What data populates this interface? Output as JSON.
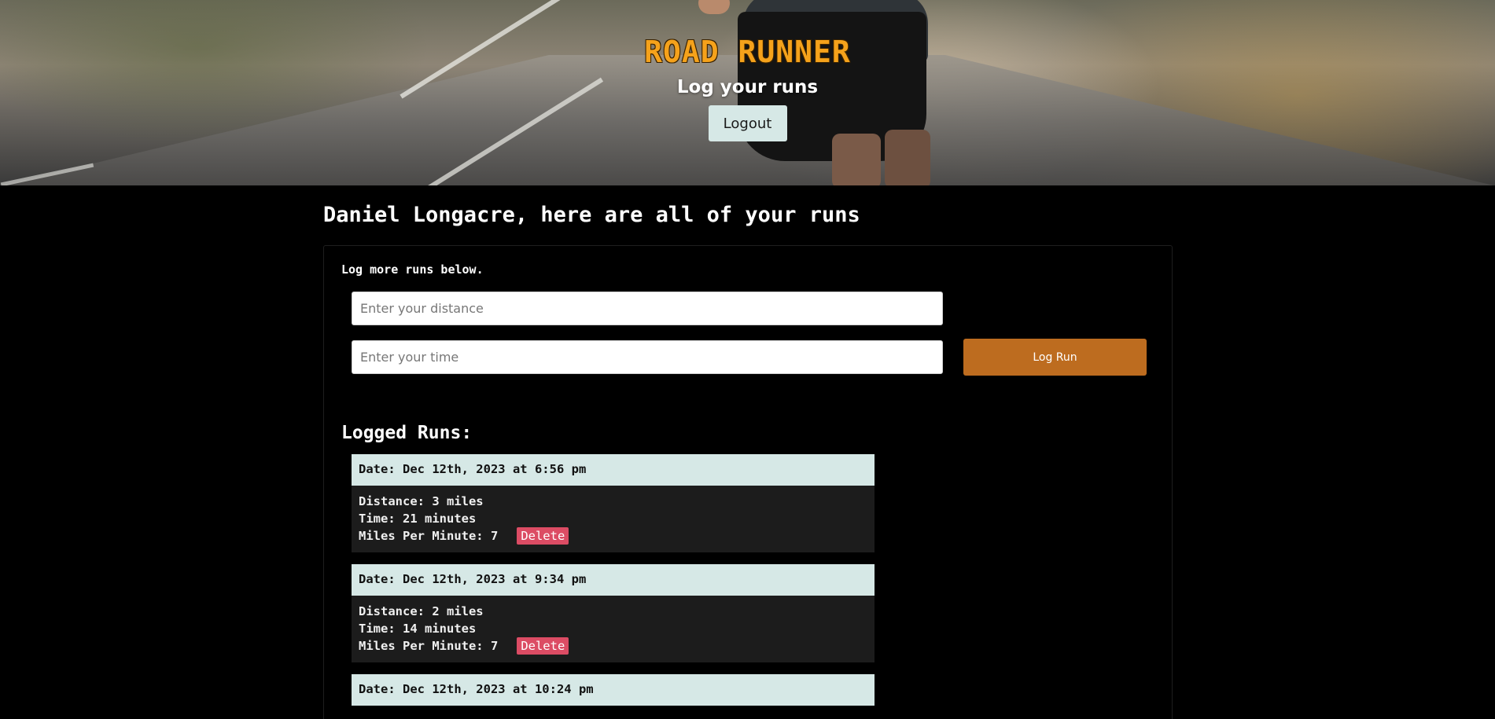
{
  "header": {
    "app_title": "ROAD RUNNER",
    "subtitle": "Log your runs",
    "logout_label": "Logout"
  },
  "main": {
    "heading": "Daniel Longacre, here are all of your runs",
    "log_prompt": "Log more runs below.",
    "distance_placeholder": "Enter your distance",
    "time_placeholder": "Enter your time",
    "log_run_label": "Log Run",
    "logged_runs_heading": "Logged Runs:"
  },
  "runs": [
    {
      "date": "Date: Dec 12th, 2023 at 6:56 pm",
      "distance": "Distance: 3 miles",
      "time": "Time: 21 minutes",
      "pace": "Miles Per Minute: 7",
      "delete_label": "Delete"
    },
    {
      "date": "Date: Dec 12th, 2023 at 9:34 pm",
      "distance": "Distance: 2 miles",
      "time": "Time: 14 minutes",
      "pace": "Miles Per Minute: 7",
      "delete_label": "Delete"
    },
    {
      "date": "Date: Dec 12th, 2023 at 10:24 pm"
    }
  ],
  "colors": {
    "title_orange": "#f5a21b",
    "log_run_button": "#bd6c1f",
    "delete_button": "#dc4c64",
    "run_header_bg": "#d6e8e6",
    "run_body_bg": "#1c1c1c"
  }
}
